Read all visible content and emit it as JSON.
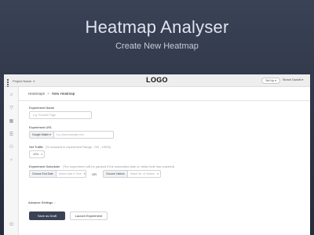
{
  "hero": {
    "title": "Heatmap Analyser",
    "subtitle": "Create New Heatmap"
  },
  "topbar": {
    "project_label": "Project Name",
    "logo": "LOGO",
    "setup_label": "Set Up",
    "user_name": "Shovel Gandhi"
  },
  "sidebar": {
    "icons": [
      "home-icon",
      "filter-icon",
      "calendar-icon",
      "list-icon",
      "users-icon",
      "trophy-icon",
      "power-icon"
    ]
  },
  "breadcrumb": {
    "root": "Heatmaps",
    "separator": ">",
    "current": "New Heatmap"
  },
  "form": {
    "experiment_name": {
      "label": "Experiment Name",
      "placeholder": "e.g. Product Page"
    },
    "experiment_url": {
      "label": "Experiment URL",
      "match_type": "Google Match",
      "placeholder": "e.g. www.example.com"
    },
    "set_traffic": {
      "label": "Set Traffic",
      "hint": "(% included in experiment Range : 0% - 100%)",
      "value": "10%"
    },
    "scheduler": {
      "label": "Experiment Scheduler",
      "hint": "(The experiment will be paused if the scheduled date or visitor limit has reached)",
      "end_date_lead": "Choose End Date",
      "end_date_placeholder": "Select Date & Time",
      "or_label": "OR",
      "visitors_lead": "Choose Visitors",
      "visitors_placeholder": "Select No. of Visitors"
    },
    "advanced_label": "Advance Settings",
    "save_draft_label": "Save as Draft",
    "launch_label": "Launch Experiment"
  }
}
